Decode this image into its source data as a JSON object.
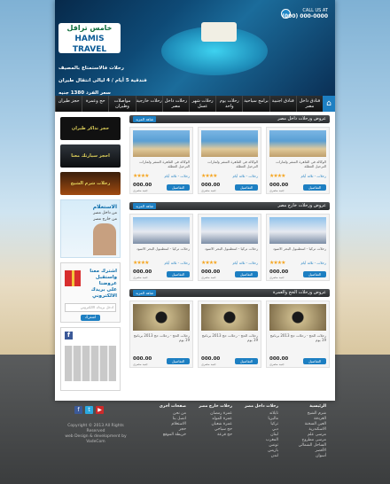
{
  "header": {
    "logo_ar": "خامس ترافل",
    "logo_en": "HAMIS TRAVEL",
    "call_label": "CALL US AT",
    "call_number": "(000) 000-0000",
    "trip_line1": "رحلات فالاستمتاع بالمصيف",
    "trip_line2": "فندقية 5 أيام / 4 ليالى انتقال طيران",
    "trip_line3": "سعر الفرد 1380 جنيه"
  },
  "nav": {
    "items": [
      "فنادق داخل مصر",
      "فنادق اجنبية",
      "برامج سياحية",
      "رحلات يوم واحد",
      "رحلات شهر عسل",
      "رحلات داخل مصر",
      "رحلات خارجية",
      "مواصلات وطيران",
      "حج وعمرة",
      "حجز طيران"
    ]
  },
  "sidebar": {
    "banner1": "حجز تذاكر طيران",
    "banner2": "احجز سيارتك معنا",
    "banner3": "رحلات شرم الشيخ",
    "reception_title": "الاستعلام",
    "reception_line1": "من داخل مصر",
    "reception_line2": "من خارج مصر",
    "newsletter_title1": "اشترك معنا",
    "newsletter_title2": "واستقبل عروضنا",
    "newsletter_title3": "على بريدك الالكتروني",
    "newsletter_placeholder": "ادخل بريدك الالكتروني",
    "newsletter_button": "اشترك"
  },
  "sections": [
    {
      "title": "عروض ورحلات داخل مصر",
      "more": "شاهد المزيد",
      "cards": [
        {
          "desc": "الوكالة فى القاهرة السفر ولمارات الترحيل العطلة",
          "loc": "رحلات - ثلاثة أيام",
          "price": "000.00",
          "currency": "جنيه مصرى",
          "btn": "التفاصيل"
        },
        {
          "desc": "الوكالة فى القاهرة السفر ولمارات الترحيل العطلة",
          "loc": "رحلات - ثلاثة أيام",
          "price": "000.00",
          "currency": "جنيه مصرى",
          "btn": "التفاصيل"
        },
        {
          "desc": "الوكالة فى القاهرة السفر ولمارات الترحيل العطلة",
          "loc": "رحلات - ثلاثة أيام",
          "price": "000.00",
          "currency": "جنيه مصرى",
          "btn": "التفاصيل"
        }
      ]
    },
    {
      "title": "عروض ورحلات خارج مصر",
      "more": "شاهد المزيد",
      "cards": [
        {
          "desc": "رحلات تركيا - اسطنبول البحر الاسود",
          "loc": "رحلات - ثلاثة أيام",
          "price": "000.00",
          "currency": "جنيه مصرى",
          "btn": "التفاصيل"
        },
        {
          "desc": "رحلات تركيا - اسطنبول البحر الاسود",
          "loc": "رحلات - ثلاثة أيام",
          "price": "000.00",
          "currency": "جنيه مصرى",
          "btn": "التفاصيل"
        },
        {
          "desc": "رحلات تركيا - اسطنبول البحر الاسود",
          "loc": "رحلات - ثلاثة أيام",
          "price": "000.00",
          "currency": "جنيه مصرى",
          "btn": "التفاصيل"
        }
      ]
    },
    {
      "title": "عروض ورحلات الحج والعمرة",
      "more": "شاهد المزيد",
      "cards": [
        {
          "desc": "رحلات الحج - رحلات حج 2013 برنامج 19 يوم",
          "loc": "",
          "price": "000.00",
          "currency": "جنيه مصرى",
          "btn": "التفاصيل"
        },
        {
          "desc": "رحلات الحج - رحلات حج 2013 برنامج 19 يوم",
          "loc": "",
          "price": "000.00",
          "currency": "جنيه مصرى",
          "btn": "التفاصيل"
        },
        {
          "desc": "رحلات الحج - رحلات حج 2013 برنامج 19 يوم",
          "loc": "",
          "price": "000.00",
          "currency": "جنيه مصرى",
          "btn": "التفاصيل"
        }
      ]
    }
  ],
  "footer": {
    "col1_head": "الرئيسية",
    "col1": [
      "شرم الشيخ",
      "الغردقة",
      "العين السخنة",
      "الاسكندرية",
      "مرسى علم",
      "مرسى مطروح",
      "الساحل الشمالي",
      "الأقصر",
      "أسوان"
    ],
    "col2_head": "رحلات داخل مصر",
    "col2": [
      "تايلاند",
      "ماليزيا",
      "تركيا",
      "دبي",
      "لبنان",
      "المغرب",
      "تونس",
      "باريس",
      "لندن"
    ],
    "col3_head": "رحلات خارج مصر",
    "col3": [
      "عمرة رمضان",
      "عمرة المولد",
      "عمرة شعبان",
      "حج سياحي",
      "حج قرعة"
    ],
    "col4_head": "صفحات أخرى",
    "col4": [
      "من نحن",
      "اتصل بنا",
      "الاستعلام",
      "حجز",
      "خريطة الموقع"
    ],
    "copyright": "Copyright © 2013 All Rights Reserved",
    "credit": "web Design & development by VadeCom"
  },
  "colors": {
    "accent": "#1d7fc2",
    "dark": "#2a2c2e",
    "star": "#f5a623"
  }
}
